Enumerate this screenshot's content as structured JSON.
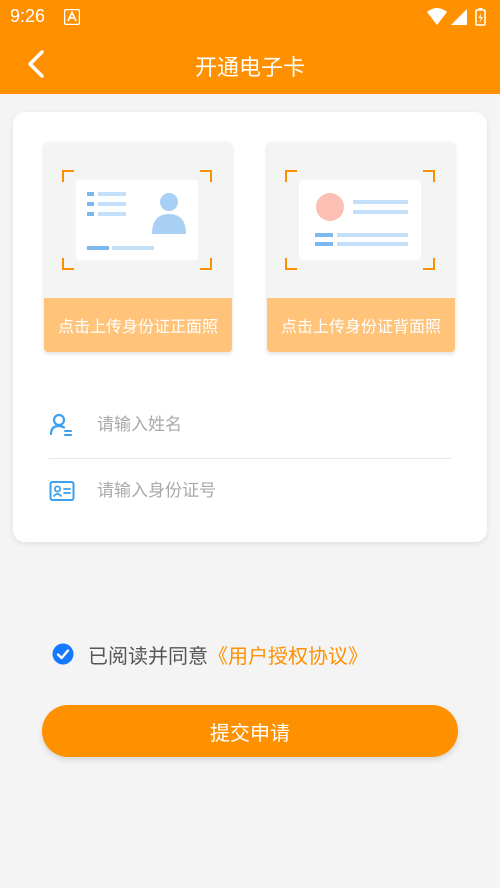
{
  "status_bar": {
    "time": "9:26"
  },
  "header": {
    "title": "开通电子卡"
  },
  "uploads": {
    "front_label": "点击上传身份证正面照",
    "back_label": "点击上传身份证背面照"
  },
  "form": {
    "name_placeholder": "请输入姓名",
    "id_placeholder": "请输入身份证号"
  },
  "agreement": {
    "checked": true,
    "text": "已阅读并同意",
    "link": "《用户授权协议》"
  },
  "submit_label": "提交申请",
  "colors": {
    "brand": "#ff9000",
    "caption_bg": "#ffc37a",
    "icon_blue": "#3aa0f0",
    "check_blue": "#1677ff"
  }
}
